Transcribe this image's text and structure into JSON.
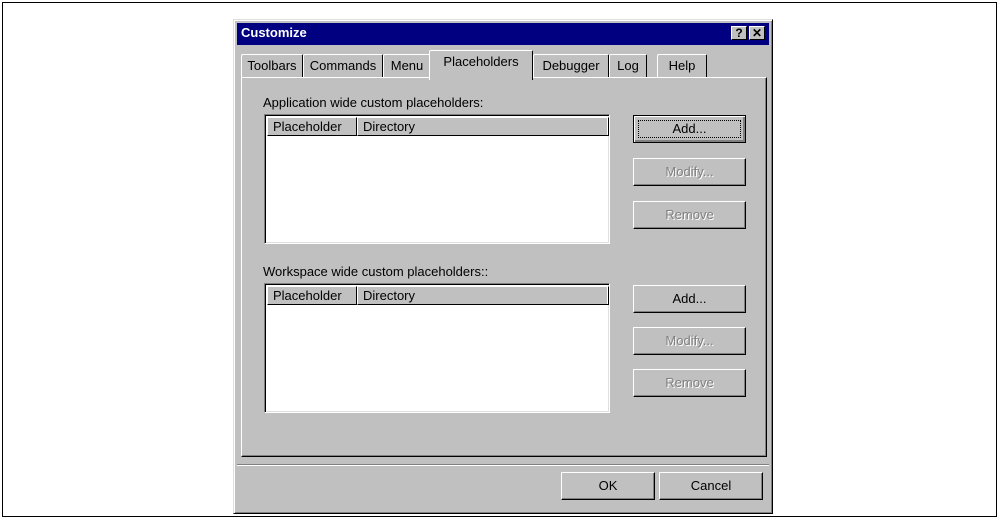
{
  "window": {
    "title": "Customize",
    "help_glyph": "?",
    "close_glyph": "✕"
  },
  "tabs": [
    {
      "label": "Toolbars",
      "active": false
    },
    {
      "label": "Commands",
      "active": false
    },
    {
      "label": "Menu",
      "active": false
    },
    {
      "label": "Placeholders",
      "active": true
    },
    {
      "label": "Debugger",
      "active": false
    },
    {
      "label": "Log",
      "active": false
    },
    {
      "label": "Help",
      "active": false
    }
  ],
  "application": {
    "label": "Application wide custom placeholders:",
    "columns": [
      "Placeholder",
      "Directory"
    ],
    "add_label": "Add...",
    "modify_label": "Modify...",
    "remove_label": "Remove"
  },
  "workspace": {
    "label": "Workspace wide custom placeholders::",
    "columns": [
      "Placeholder",
      "Directory"
    ],
    "add_label": "Add...",
    "modify_label": "Modify...",
    "remove_label": "Remove"
  },
  "footer": {
    "ok_label": "OK",
    "cancel_label": "Cancel"
  },
  "colors": {
    "face": "#c0c0c0",
    "titlebar": "#000080",
    "disabled_text": "#808080"
  }
}
